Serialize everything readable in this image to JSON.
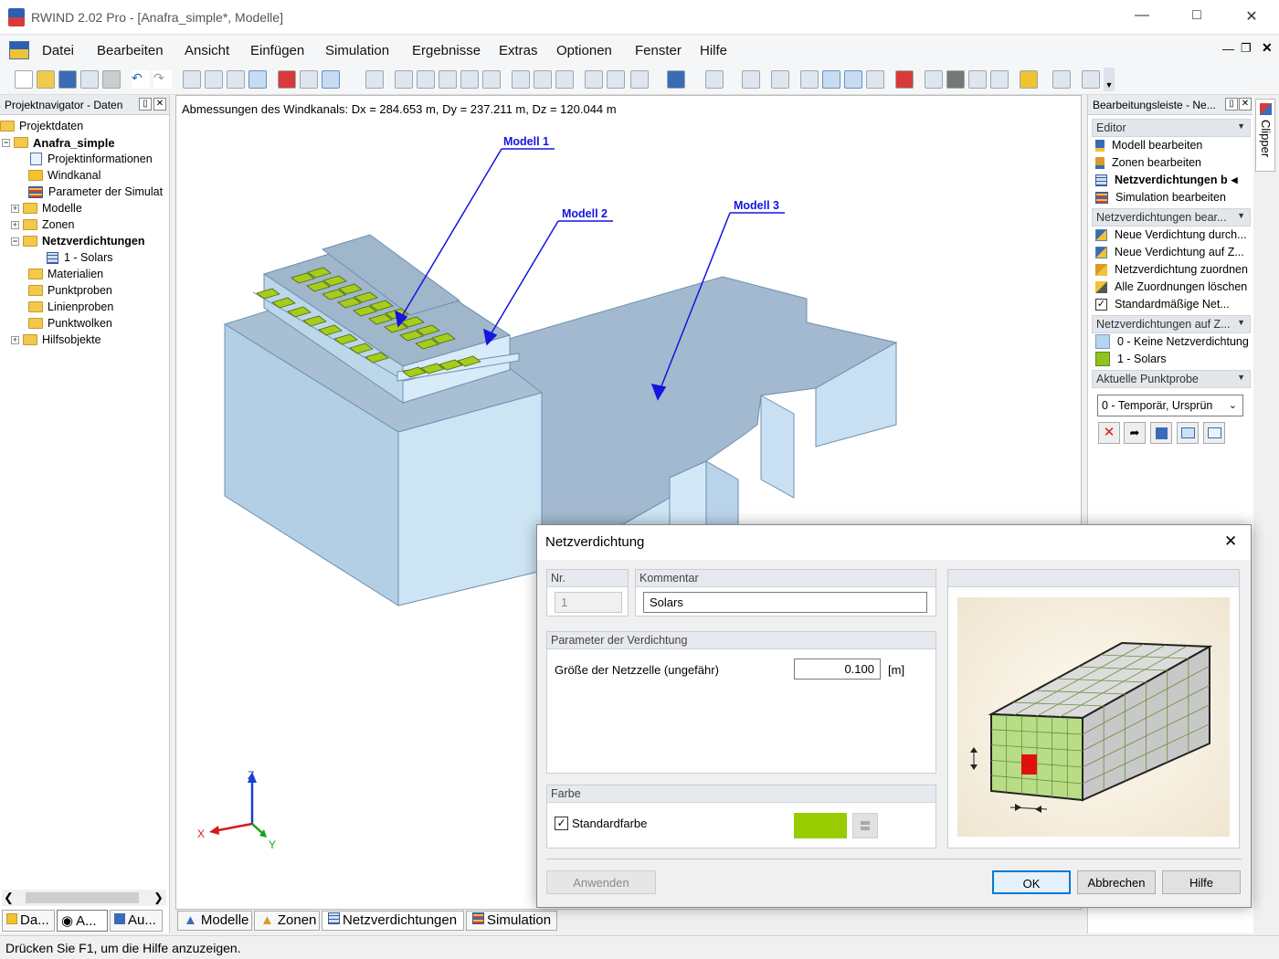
{
  "window": {
    "title": "RWIND 2.02 Pro - [Anafra_simple*, Modelle]"
  },
  "menu": [
    "Datei",
    "Bearbeiten",
    "Ansicht",
    "Einfügen",
    "Simulation",
    "Ergebnisse",
    "Extras",
    "Optionen",
    "Fenster",
    "Hilfe"
  ],
  "navigator": {
    "title": "Projektnavigator - Daten",
    "root": "Projektdaten",
    "project": "Anafra_simple",
    "items": [
      {
        "label": "Projektinformationen",
        "icon": "document-icon"
      },
      {
        "label": "Windkanal",
        "icon": "wind-tunnel-icon"
      },
      {
        "label": "Parameter der Simulat",
        "icon": "parameters-icon"
      },
      {
        "label": "Modelle",
        "icon": "folder-icon"
      },
      {
        "label": "Zonen",
        "icon": "folder-icon"
      },
      {
        "label": "Netzverdichtungen",
        "icon": "folder-icon"
      },
      {
        "label": "1 - Solars",
        "icon": "mesh-icon"
      },
      {
        "label": "Materialien",
        "icon": "folder-icon"
      },
      {
        "label": "Punktproben",
        "icon": "folder-icon"
      },
      {
        "label": "Linienproben",
        "icon": "folder-icon"
      },
      {
        "label": "Punktwolken",
        "icon": "folder-icon"
      },
      {
        "label": "Hilfsobjekte",
        "icon": "folder-icon"
      }
    ],
    "tabs": [
      "Da...",
      "A...",
      "Au..."
    ]
  },
  "viewport": {
    "dimensions_label": "Abmessungen des Windkanals: Dx = 284.653 m, Dy = 237.211 m, Dz = 120.044 m",
    "annotations": [
      "Modell 1",
      "Modell 2",
      "Modell 3"
    ],
    "axes": {
      "x": "X",
      "y": "Y",
      "z": "Z"
    }
  },
  "bottom_tabs": [
    "Modelle",
    "Zonen",
    "Netzverdichtungen",
    "Simulation"
  ],
  "right_panel": {
    "title": "Bearbeitungsleiste - Ne...",
    "side_tab": "Clipper",
    "sections": [
      {
        "title": "Editor",
        "items": [
          "Modell bearbeiten",
          "Zonen bearbeiten",
          "Netzverdichtungen b",
          "Simulation bearbeiten"
        ]
      },
      {
        "title": "Netzverdichtungen bear...",
        "items": [
          "Neue Verdichtung durch...",
          "Neue Verdichtung auf Z...",
          "Netzverdichtung zuordnen",
          "Alle Zuordnungen löschen",
          "Standardmäßige Net..."
        ]
      },
      {
        "title": "Netzverdichtungen auf Z...",
        "items": [
          "0 - Keine Netzverdichtung",
          "1 - Solars"
        ]
      },
      {
        "title": "Aktuelle Punktprobe",
        "items": []
      }
    ],
    "point_probe_select": "0 - Temporär, Ursprün",
    "zone_colors": [
      "#b9d3ef",
      "#8fc31f"
    ]
  },
  "dialog": {
    "title": "Netzverdichtung",
    "nr_label": "Nr.",
    "nr_value": "1",
    "comment_label": "Kommentar",
    "comment_value": "Solars",
    "params_label": "Parameter der Verdichtung",
    "cell_size_label": "Größe der Netzzelle (ungefähr)",
    "cell_size_value": "0.100",
    "cell_size_unit": "[m]",
    "color_label": "Farbe",
    "default_color_label": "Standardfarbe",
    "default_color_checked": true,
    "color_value": "#99cc00",
    "buttons": {
      "apply": "Anwenden",
      "ok": "OK",
      "cancel": "Abbrechen",
      "help": "Hilfe"
    }
  },
  "status": "Drücken Sie F1, um die Hilfe anzuzeigen."
}
